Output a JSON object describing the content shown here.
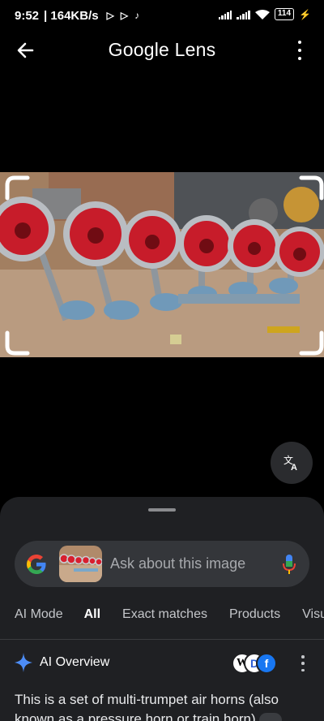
{
  "status": {
    "time": "9:52",
    "speed": "| 164KB/s",
    "battery": "114",
    "icons": [
      "play-icon",
      "play-icon",
      "tiktok-icon",
      "signal-icon",
      "signal-icon",
      "wifi-icon",
      "battery-icon",
      "charging-icon"
    ]
  },
  "header": {
    "title": "Google Lens"
  },
  "search": {
    "placeholder": "Ask about this image"
  },
  "tabs": [
    {
      "label": "AI Mode",
      "active": false
    },
    {
      "label": "All",
      "active": true
    },
    {
      "label": "Exact matches",
      "active": false
    },
    {
      "label": "Products",
      "active": false
    },
    {
      "label": "Visu",
      "active": false
    }
  ],
  "ai_overview": {
    "title": "AI Overview",
    "text": "This is a set of multi-trumpet air horns (also known as a pressure horn or train horn)"
  },
  "colors": {
    "sheet": "#1f2023",
    "search_bar": "#34363a",
    "accent_horn": "#d81f2e"
  }
}
